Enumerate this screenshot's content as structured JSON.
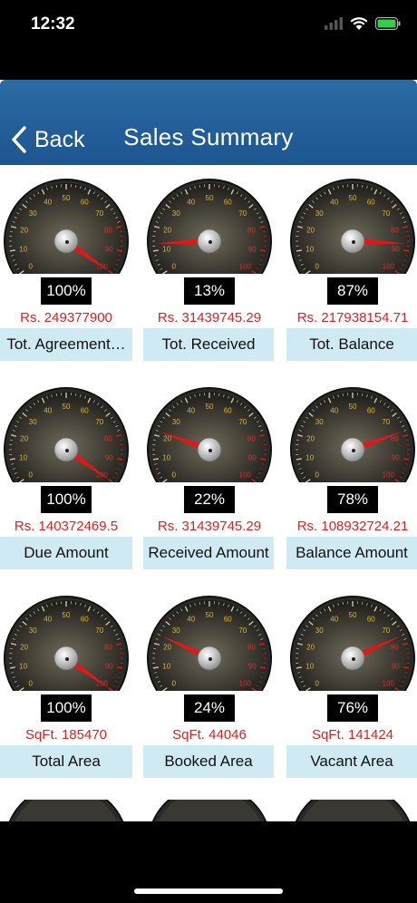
{
  "status_bar": {
    "time": "12:32"
  },
  "navbar": {
    "back_label": "Back",
    "title": "Sales Summary"
  },
  "gauge_scale": [
    "0",
    "10",
    "20",
    "30",
    "40",
    "50",
    "60",
    "70",
    "80",
    "90",
    "100"
  ],
  "tiles": [
    {
      "percent_label": "100%",
      "percent": 100,
      "value": "Rs. 249377900",
      "label": "Tot. Agreement…"
    },
    {
      "percent_label": "13%",
      "percent": 13,
      "value": "Rs. 31439745.29",
      "label": "Tot. Received"
    },
    {
      "percent_label": "87%",
      "percent": 87,
      "value": "Rs. 217938154.71",
      "label": "Tot. Balance"
    },
    {
      "percent_label": "100%",
      "percent": 100,
      "value": "Rs. 140372469.5",
      "label": "Due Amount"
    },
    {
      "percent_label": "22%",
      "percent": 22,
      "value": "Rs. 31439745.29",
      "label": "Received Amount"
    },
    {
      "percent_label": "78%",
      "percent": 78,
      "value": "Rs. 108932724.21",
      "label": "Balance Amount"
    },
    {
      "percent_label": "100%",
      "percent": 100,
      "value": "SqFt. 185470",
      "label": "Total Area"
    },
    {
      "percent_label": "24%",
      "percent": 24,
      "value": "SqFt. 44046",
      "label": "Booked Area"
    },
    {
      "percent_label": "76%",
      "percent": 76,
      "value": "SqFt. 141424",
      "label": "Vacant Area"
    }
  ],
  "colors": {
    "nav": "#2562a0",
    "value_red": "#e02020",
    "label_bg": "#cfeaf3",
    "needle": "#e01818"
  }
}
